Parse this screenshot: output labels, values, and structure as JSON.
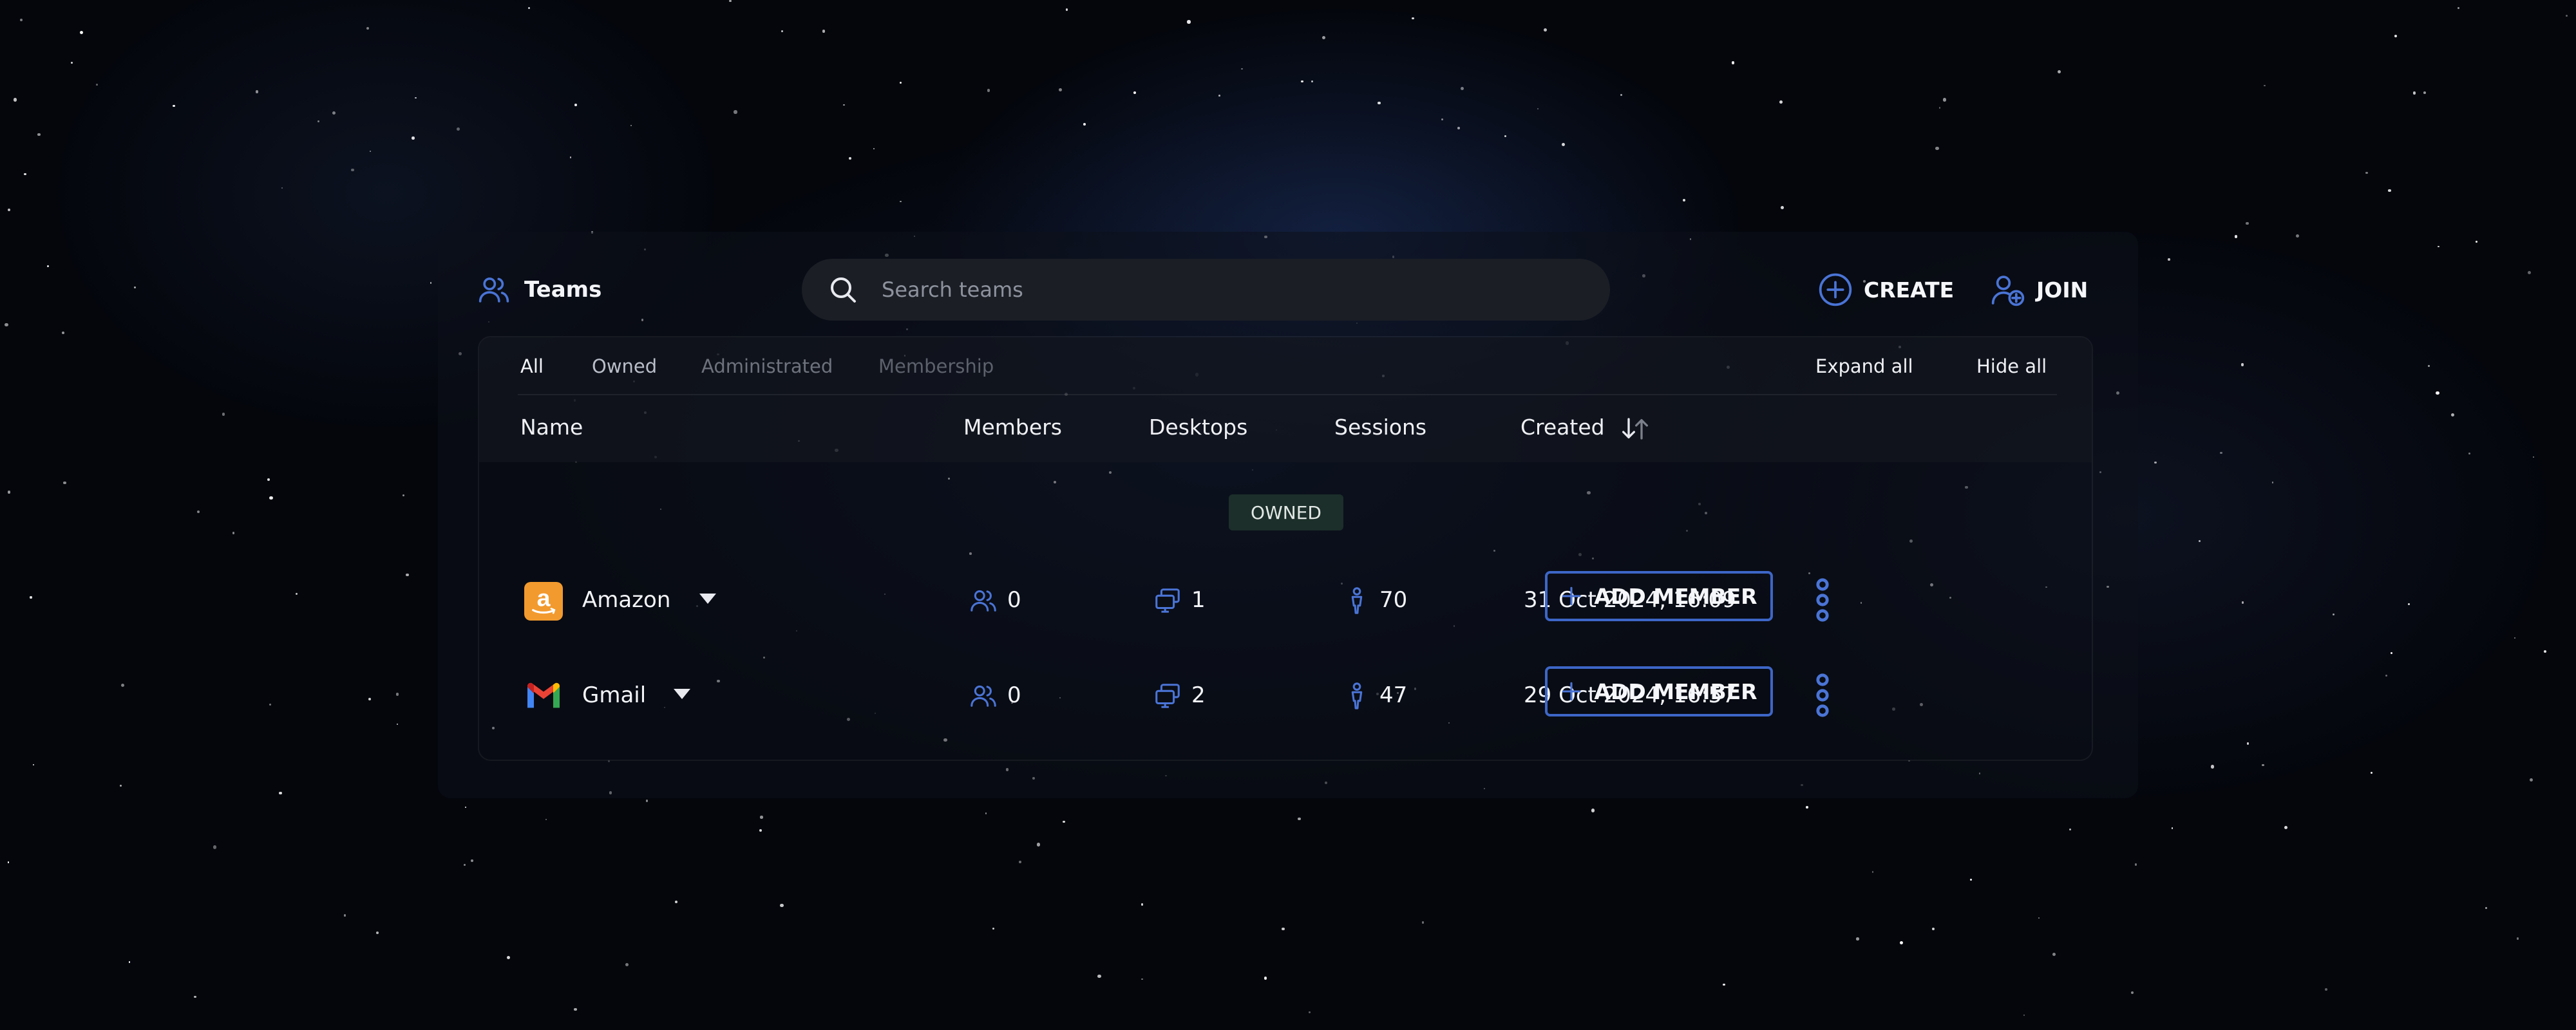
{
  "header": {
    "title": "Teams",
    "title_icon": "users-icon"
  },
  "search": {
    "placeholder": "Search teams",
    "value": "",
    "icon": "search-icon"
  },
  "actions": {
    "create_label": "CREATE",
    "create_icon": "plus-circle-icon",
    "join_label": "JOIN",
    "join_icon": "user-plus-icon"
  },
  "filters": {
    "tabs": [
      {
        "label": "All",
        "active": true
      },
      {
        "label": "Owned",
        "active": false
      },
      {
        "label": "Administrated",
        "active": false
      },
      {
        "label": "Membership",
        "active": false
      }
    ],
    "expand_all_label": "Expand all",
    "hide_all_label": "Hide all"
  },
  "table": {
    "columns": {
      "name": "Name",
      "members": "Members",
      "desktops": "Desktops",
      "sessions": "Sessions",
      "created": "Created"
    },
    "sort": {
      "column": "created",
      "icon": "sort-arrows-icon"
    },
    "group_label": "OWNED",
    "add_member_label": "ADD MEMBER",
    "rows": [
      {
        "name": "Amazon",
        "logo": "amazon-logo-icon",
        "members": "0",
        "desktops": "1",
        "sessions": "70",
        "created": "31 Oct 2024, 16:09"
      },
      {
        "name": "Gmail",
        "logo": "gmail-logo-icon",
        "members": "0",
        "desktops": "2",
        "sessions": "47",
        "created": "29 Oct 2024, 16:57"
      }
    ]
  },
  "colors": {
    "accent": "#3d66c7",
    "icon_blue": "#4a74d6",
    "badge_bg": "#1c2f2a",
    "amazon_orange": "#f29a2e"
  }
}
